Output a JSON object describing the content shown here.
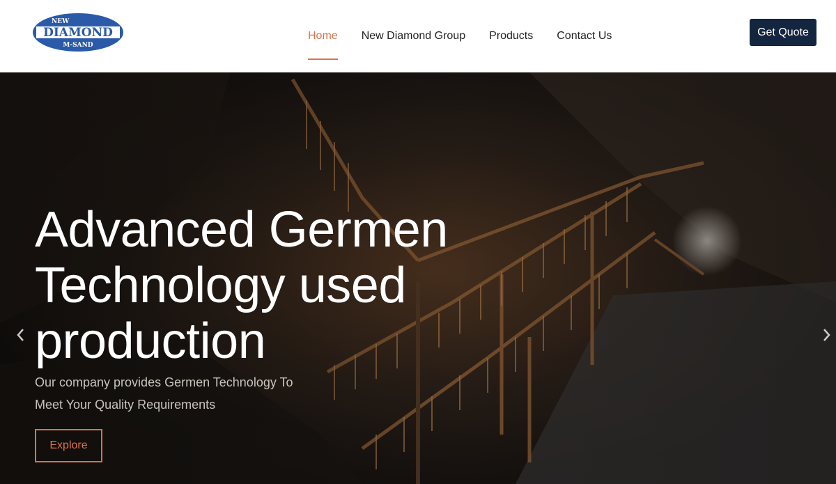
{
  "brand": {
    "logo_top": "NEW",
    "logo_main": "DIAMOND",
    "logo_bottom": "M-SAND",
    "primary_color": "#2a5aa8"
  },
  "nav": {
    "items": [
      {
        "label": "Home",
        "active": true
      },
      {
        "label": "New Diamond Group",
        "active": false
      },
      {
        "label": "Products",
        "active": false
      },
      {
        "label": "Contact Us",
        "active": false
      }
    ],
    "cta_label": "Get Quote"
  },
  "hero": {
    "title_line1": "Advanced Germen",
    "title_line2": "Technology used",
    "title_line3": "production",
    "subtitle_line1": "Our company provides Germen Technology To",
    "subtitle_line2": "Meet Your Quality Requirements",
    "button_label": "Explore",
    "prev_icon": "chevron-left-icon",
    "next_icon": "chevron-right-icon"
  },
  "colors": {
    "accent": "#d8734e",
    "cta_bg": "#13253f"
  }
}
